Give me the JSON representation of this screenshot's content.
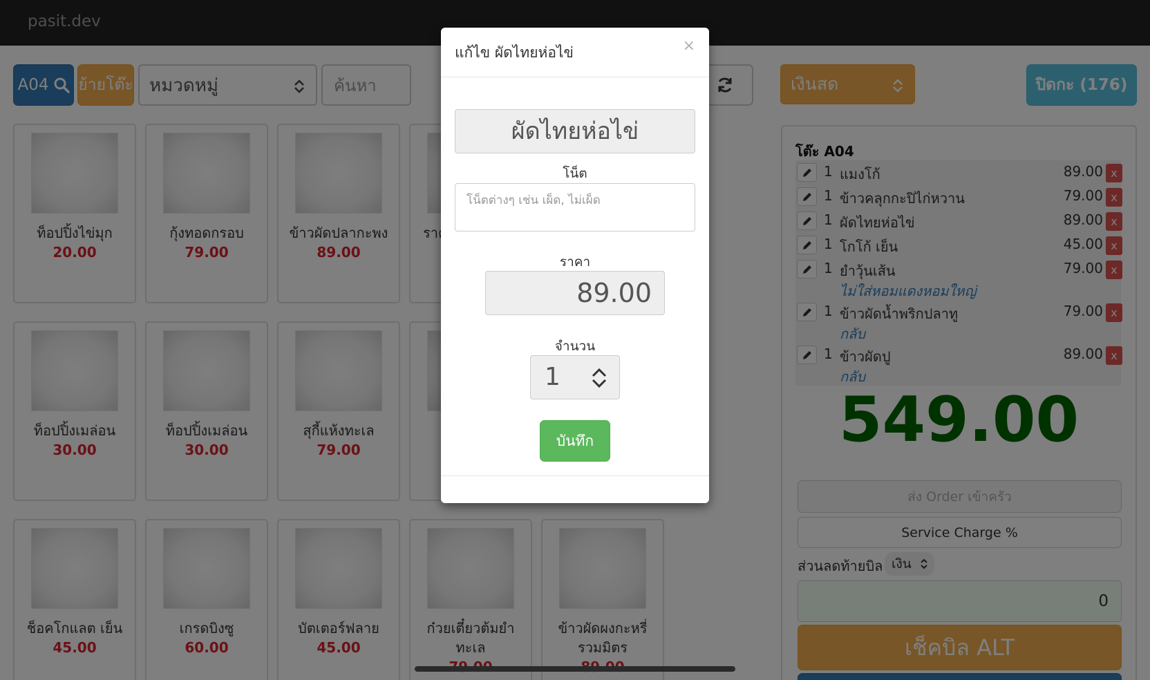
{
  "brand": "pasit.dev",
  "toolbar": {
    "table_button": "A04",
    "move_table_button": "ย้ายโต๊ะ",
    "category_select": "หมวดหมู่",
    "search_placeholder": "ค้นหา",
    "payment_select": "เงินสด",
    "close_day_button": "ปิดกะ (176)"
  },
  "menu_items": [
    {
      "name": "ท็อปปิ้งไข่มุก",
      "price": "20.00"
    },
    {
      "name": "กุ้งทอดกรอบ",
      "price": "79.00"
    },
    {
      "name": "ข้าวผัดปลากะพง",
      "price": "89.00"
    },
    {
      "name": "ราค",
      "price": ""
    },
    {
      "name": "ท็อปปิ้งเมล่อน",
      "price": "30.00"
    },
    {
      "name": "ท็อปปิ้งเมล่อน",
      "price": "30.00"
    },
    {
      "name": "สุกี้แห้งทะเล",
      "price": "79.00"
    },
    {
      "name": "ช็อคโกแลต เย็น",
      "price": "45.00"
    },
    {
      "name": "เกรดบิงซู",
      "price": "60.00"
    },
    {
      "name": "บัตเตอร์ฟลาย",
      "price": "45.00"
    },
    {
      "name": "ก๋วยเตี๋ยวต้มยำทะเล",
      "price": "79.00"
    },
    {
      "name": "ข้าวผัดผงกะหรี่ รวมมิตร",
      "price": "89.00"
    }
  ],
  "order": {
    "table_title": "โต๊ะ A04",
    "items": [
      {
        "qty": "1",
        "name": "แมงโก้",
        "price": "89.00",
        "note": ""
      },
      {
        "qty": "1",
        "name": "ข้าวคลุกกะปิไก่หวาน",
        "price": "79.00",
        "note": ""
      },
      {
        "qty": "1",
        "name": "ผัดไทยห่อไข่",
        "price": "89.00",
        "note": ""
      },
      {
        "qty": "1",
        "name": "โกโก้ เย็น",
        "price": "45.00",
        "note": ""
      },
      {
        "qty": "1",
        "name": "ยำวุ้นเส้น",
        "price": "79.00",
        "note": "ไม่ใส่หอมแดงหอมใหญ่"
      },
      {
        "qty": "1",
        "name": "ข้าวผัดน้ำพริกปลาทู",
        "price": "79.00",
        "note": "กลับ"
      },
      {
        "qty": "1",
        "name": "ข้าวผัดปู",
        "price": "89.00",
        "note": "กลับ"
      }
    ],
    "delete_label": "x",
    "total": "549.00",
    "send_order_button": "ส่ง Order เข้าครัว",
    "service_charge_button": "Service Charge %",
    "discount_label": "ส่วนลดท้ายบิล",
    "discount_type": "เงิน",
    "discount_value": "0",
    "checkbill_button": "เช็คบิล ALT"
  },
  "modal": {
    "title": "แก้ไข ผัดไทยห่อไข่",
    "close": "×",
    "item_name": "ผัดไทยห่อไข่",
    "note_label": "โน็ต",
    "note_placeholder": "โน็ตต่างๆ เช่น เผ็ด, ไม่เผ็ด",
    "price_label": "ราคา",
    "price_value": "89.00",
    "qty_label": "จำนวน",
    "qty_value": "1",
    "save_button": "บันทึก"
  }
}
